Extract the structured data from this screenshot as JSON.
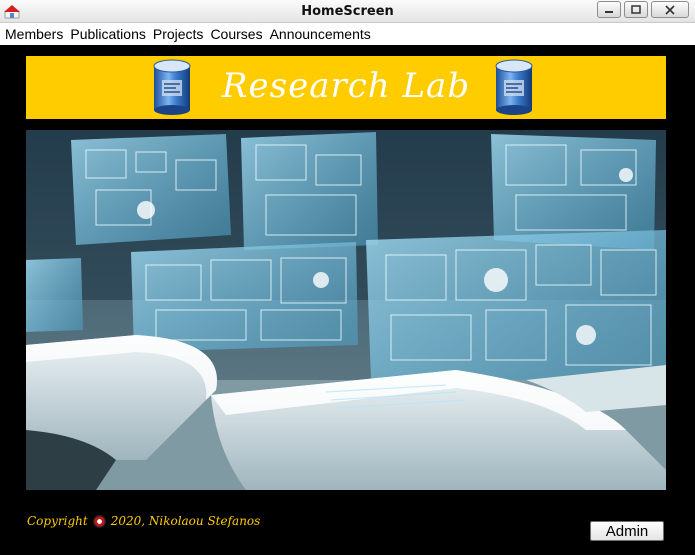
{
  "window": {
    "title": "HomeScreen"
  },
  "menu": {
    "items": [
      {
        "label": "Members"
      },
      {
        "label": "Publications"
      },
      {
        "label": "Projects"
      },
      {
        "label": "Courses"
      },
      {
        "label": "Announcements"
      }
    ]
  },
  "banner": {
    "title": "Research Lab",
    "background": "#ffcc00"
  },
  "footer": {
    "copyright_prefix": "Copyright",
    "copyright_suffix": "2020, Nikolaou Stefanos",
    "admin_label": "Admin"
  }
}
